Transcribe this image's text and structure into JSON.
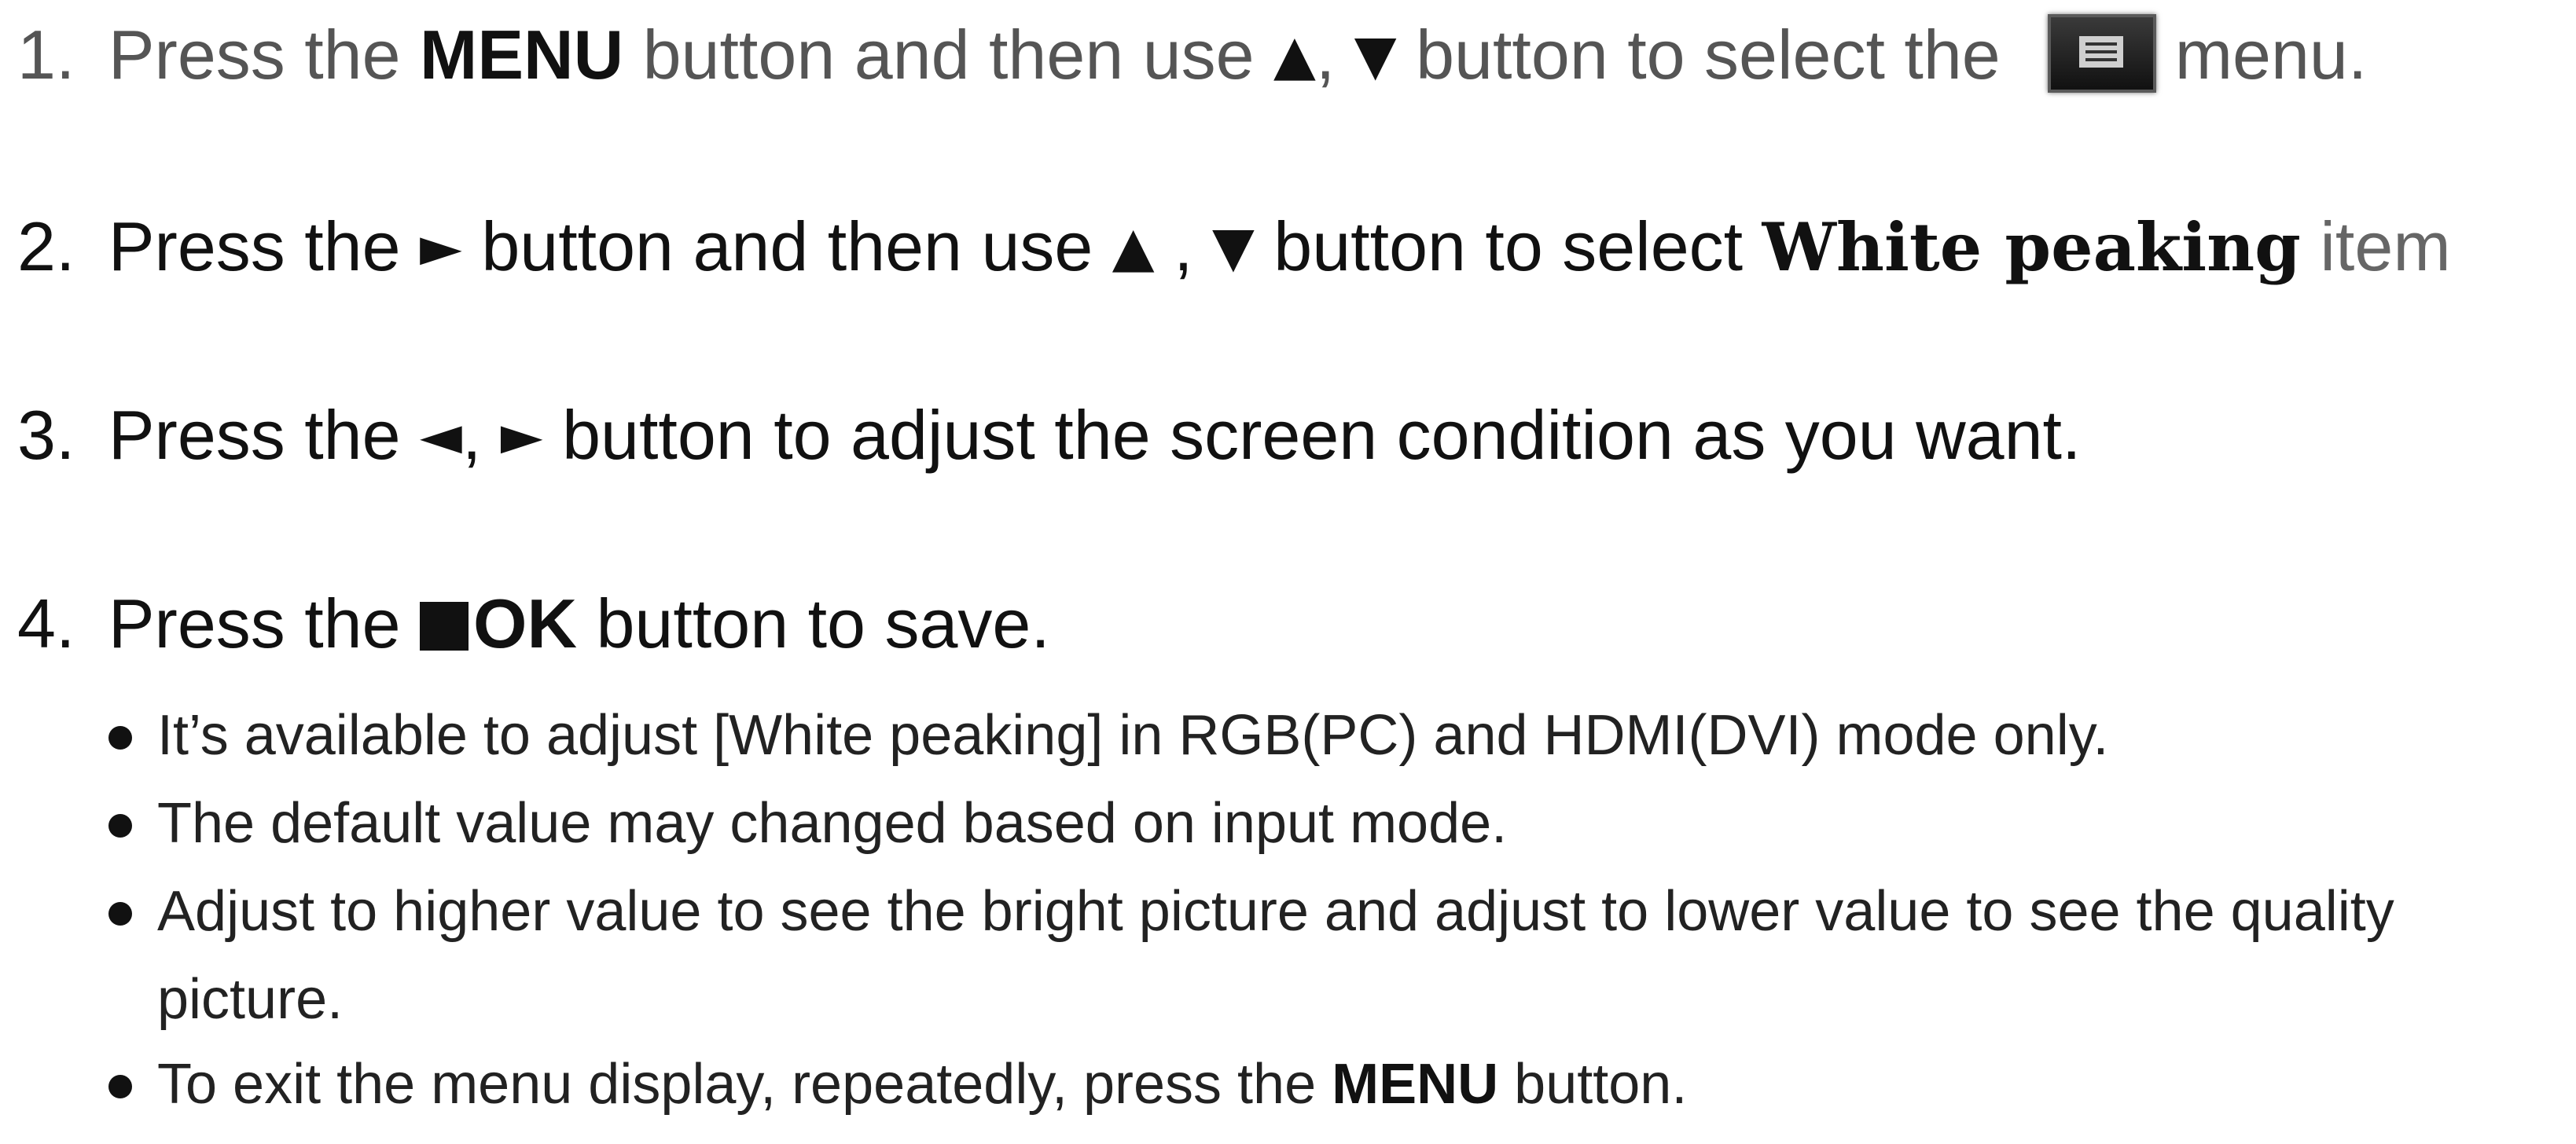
{
  "steps": [
    {
      "number": "1.",
      "t1": "Press the",
      "menu": "MENU",
      "t2": "button and then use",
      "up": "▲",
      "comma": ",",
      "down": "▼",
      "t3": "button to select the",
      "icon": "menu-icon",
      "t4": "menu."
    },
    {
      "number": "2.",
      "t1": "Press the",
      "right": "►",
      "t2": "button and then use",
      "up": "▲",
      "comma": " ,",
      "down": "▼",
      "t3": "button to select",
      "item": "White peaking",
      "t4": "item"
    },
    {
      "number": "3.",
      "t1": "Press the",
      "left": "◄",
      "comma": ",",
      "right": "►",
      "t2": "button to adjust the screen condition as you want."
    },
    {
      "number": "4.",
      "t1": "Press the",
      "ok": "OK",
      "t2": "button to save."
    }
  ],
  "notes": [
    {
      "text": "It’s available to adjust [White peaking] in RGB(PC) and HDMI(DVI) mode only."
    },
    {
      "text": "The default value may changed based on input mode."
    },
    {
      "text": "Adjust  to higher value to see the bright picture and adjust to lower value to see the quality picture."
    },
    {
      "t1": "To exit the menu display, repeatedly, press the",
      "menu": "MENU",
      "t2": "button."
    }
  ]
}
